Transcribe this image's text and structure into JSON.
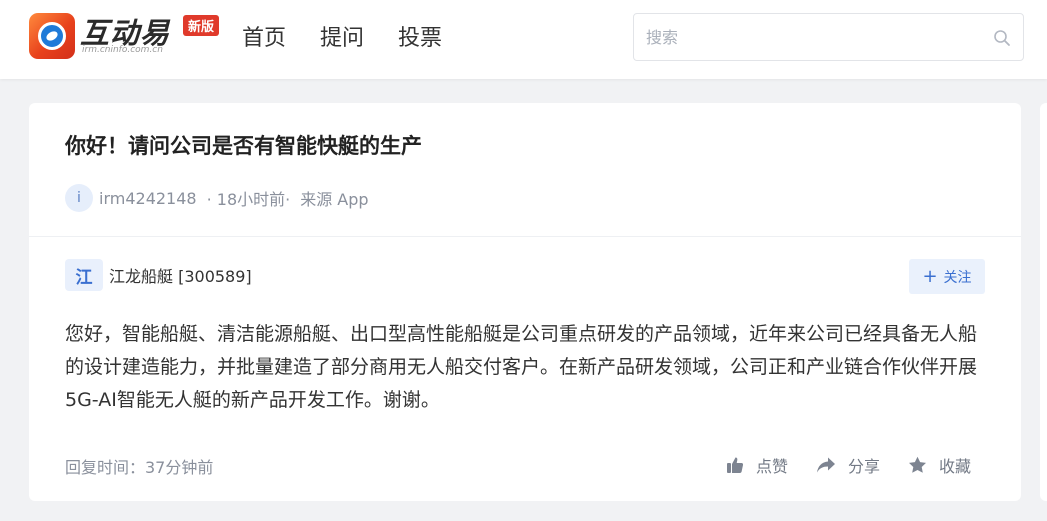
{
  "header": {
    "brand_name": "互动易",
    "brand_url": "irm.cninfo.com.cn",
    "badge": "新版",
    "nav": [
      "首页",
      "提问",
      "投票"
    ],
    "search_placeholder": "搜索"
  },
  "question": {
    "title": "你好！请问公司是否有智能快艇的生产",
    "avatar_letter": "i",
    "user": "irm4242148",
    "time": "· 18小时前·",
    "source": "来源 App"
  },
  "answer": {
    "company_logo_char": "江",
    "company": "江龙船艇 [300589]",
    "follow_label": "关注",
    "text": "您好，智能船艇、清洁能源船艇、出口型高性能船艇是公司重点研发的产品领域，近年来公司已经具备无人船的设计建造能力，并批量建造了部分商用无人船交付客户。在新产品研发领域，公司正和产业链合作伙伴开展5G-AI智能无人艇的新产品开发工作。谢谢。",
    "reply_time": "回复时间：37分钟前",
    "actions": {
      "like": "点赞",
      "share": "分享",
      "favorite": "收藏"
    }
  },
  "colors": {
    "accent": "#3a6fd0",
    "badge": "#e03a2b",
    "muted": "#8a909c",
    "background": "#f1f2f4"
  }
}
